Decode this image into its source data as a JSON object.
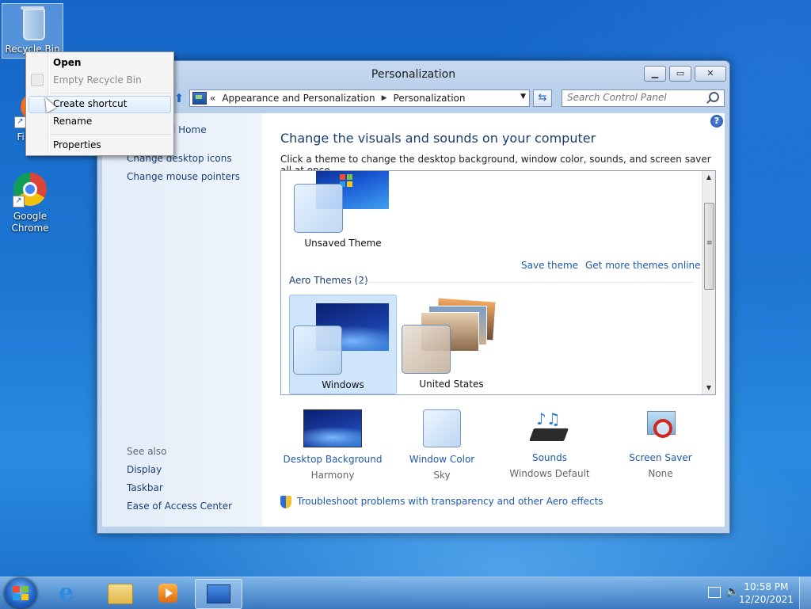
{
  "desktop": {
    "icons": [
      {
        "label": "Recycle Bin"
      },
      {
        "label": "Fi"
      },
      {
        "label": "Google Chrome"
      }
    ]
  },
  "window": {
    "title": "Personalization",
    "address": {
      "prefix": "«",
      "segments": [
        "Appearance and Personalization",
        "Personalization"
      ]
    },
    "search_placeholder": "Search Control Panel"
  },
  "leftpane": {
    "links": [
      "nel Home",
      "Change desktop icons",
      "Change mouse pointers"
    ],
    "see_also_label": "See also",
    "see_also": [
      "Display",
      "Taskbar",
      "Ease of Access Center"
    ]
  },
  "main": {
    "heading": "Change the visuals and sounds on your computer",
    "subtitle": "Click a theme to change the desktop background, window color, sounds, and screen saver all at once.",
    "unsaved_theme": "Unsaved Theme",
    "save_theme": "Save theme",
    "get_more": "Get more themes online",
    "aero_section": "Aero Themes (2)",
    "themes": [
      "Windows",
      "United States"
    ],
    "bottom": [
      {
        "title": "Desktop Background",
        "sub": "Harmony"
      },
      {
        "title": "Window Color",
        "sub": "Sky"
      },
      {
        "title": "Sounds",
        "sub": "Windows Default"
      },
      {
        "title": "Screen Saver",
        "sub": "None"
      }
    ],
    "troubleshoot": "Troubleshoot problems with transparency and other Aero effects"
  },
  "context_menu": {
    "items": [
      "Open",
      "Empty Recycle Bin",
      "Create shortcut",
      "Rename",
      "Properties"
    ]
  },
  "taskbar": {
    "time": "10:58 PM",
    "date": "12/20/2021"
  },
  "colors": {
    "link": "#1e5aa8",
    "heading": "#1c3c72",
    "desktop": "#1d76d2"
  }
}
